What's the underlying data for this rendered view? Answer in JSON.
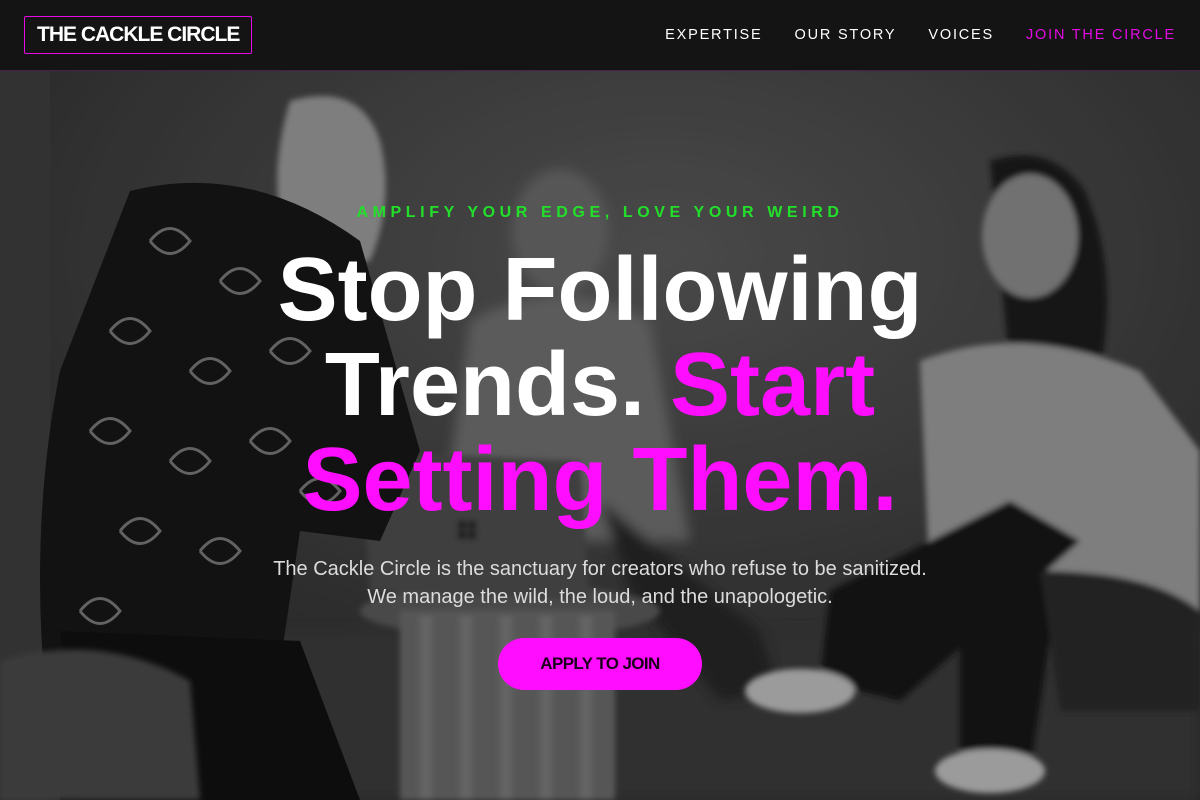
{
  "brand": {
    "logo_text": "THE CACKLE CIRCLE"
  },
  "nav": {
    "items": [
      {
        "label": "EXPERTISE"
      },
      {
        "label": "OUR STORY"
      },
      {
        "label": "VOICES"
      },
      {
        "label": "JOIN THE CIRCLE"
      }
    ]
  },
  "hero": {
    "eyebrow": "AMPLIFY YOUR EDGE, LOVE YOUR WEIRD",
    "headline_line1": "Stop Following",
    "headline_line2_white": "Trends. ",
    "headline_line2_accent": "Start",
    "headline_line3_accent": "Setting Them.",
    "subtext_line1": "The Cackle Circle is the sanctuary for creators who refuse to be sanitized.",
    "subtext_line2": "We manage the wild, the loud, and the unapologetic.",
    "cta_label": "APPLY TO JOIN"
  },
  "colors": {
    "accent_magenta": "#ff0dff",
    "eyebrow_green": "#22e02a",
    "nav_background": "#141414"
  }
}
